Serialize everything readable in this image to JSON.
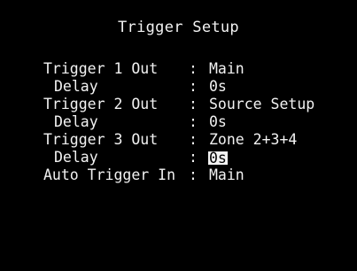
{
  "title": "Trigger Setup",
  "separator": ":",
  "rows": [
    {
      "label": "Trigger 1 Out",
      "value": "Main"
    },
    {
      "label": "Delay",
      "value": "0s"
    },
    {
      "label": "Trigger 2 Out",
      "value": "Source Setup"
    },
    {
      "label": "Delay",
      "value": "0s"
    },
    {
      "label": "Trigger 3 Out",
      "value": "Zone 2+3+4"
    },
    {
      "label": "Delay",
      "value": "0s"
    },
    {
      "label": "Auto Trigger In",
      "value": "Main"
    }
  ],
  "selected_row": 5,
  "colors": {
    "background": "#000000",
    "text": "#f2f2f2",
    "highlight_bg": "#f2f2f2",
    "highlight_text": "#000000"
  }
}
